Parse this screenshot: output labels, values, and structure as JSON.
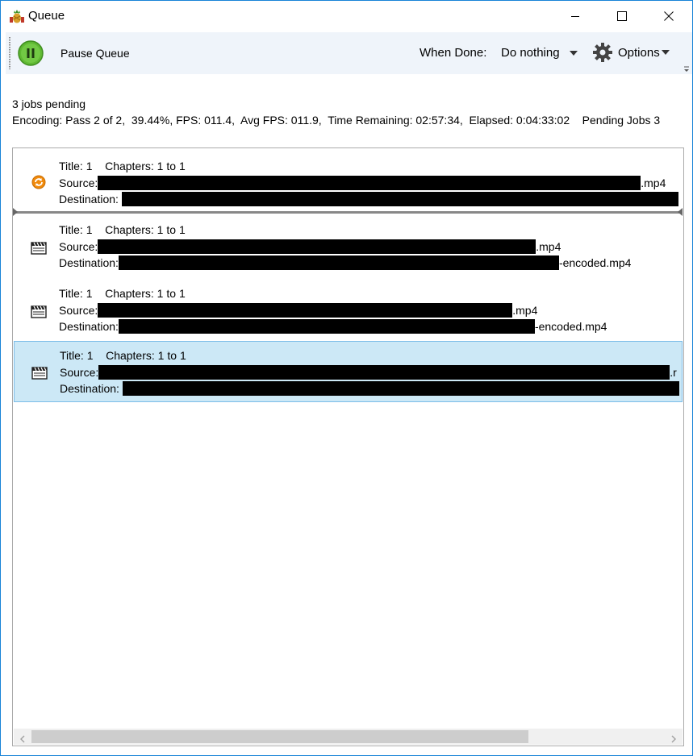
{
  "window": {
    "title": "Queue",
    "icon": "handbrake-pineapple-icon"
  },
  "toolbar": {
    "pause_label": "Pause Queue",
    "when_done_label": "When Done:",
    "when_done_value": "Do nothing",
    "options_label": "Options"
  },
  "status": {
    "jobs_pending": "3 jobs pending",
    "encoding": "Encoding: Pass 2 of 2,  39.44%, FPS: 011.4,  Avg FPS: 011.9,  Time Remaining: 02:57:34,  Elapsed: 0:04:33:02    Pending Jobs 3"
  },
  "labels": {
    "title": "Title:",
    "chapters": "Chapters:",
    "to": "to",
    "source": "Source:",
    "destination": "Destination:"
  },
  "jobs": [
    {
      "status_icon": "encoding-in-progress-icon",
      "title": "1",
      "chapter_start": "1",
      "chapter_end": "1",
      "source_suffix": ".mp4",
      "destination_suffix": ""
    },
    {
      "status_icon": "clapperboard-icon",
      "title": "1",
      "chapter_start": "1",
      "chapter_end": "1",
      "source_suffix": ".mp4",
      "destination_suffix": "-encoded.mp4"
    },
    {
      "status_icon": "clapperboard-icon",
      "title": "1",
      "chapter_start": "1",
      "chapter_end": "1",
      "source_suffix": ".mp4",
      "destination_suffix": "-encoded.mp4"
    },
    {
      "status_icon": "clapperboard-icon",
      "title": "1",
      "chapter_start": "1",
      "chapter_end": "1",
      "source_suffix": ".r",
      "destination_suffix": ""
    }
  ],
  "colors": {
    "window_border": "#1883d7",
    "toolbar_bg": "#eff4fa",
    "selected_bg": "#cce8f6",
    "selected_border": "#7cbde8",
    "pause_button": "#5fb832"
  }
}
